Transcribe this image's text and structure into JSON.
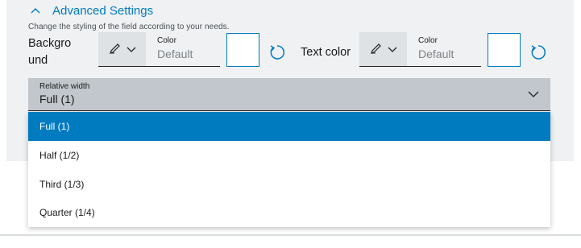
{
  "section": {
    "title": "Advanced Settings",
    "help": "Change the styling of the field according to your needs."
  },
  "background": {
    "label_line1": "Backgro",
    "label_line2": "und",
    "color_label": "Color",
    "color_value": "Default"
  },
  "text_color": {
    "label": "Text color",
    "color_label": "Color",
    "color_value": "Default"
  },
  "relative_width": {
    "label": "Relative width",
    "value": "Full (1)",
    "options": [
      "Full (1)",
      "Half (1/2)",
      "Third (1/3)",
      "Quarter (1/4)"
    ],
    "selected_index": 0
  },
  "colors": {
    "accent": "#007bc0",
    "panel": "#eff1f2",
    "select_bg": "#c1c7cc"
  },
  "icons": {
    "collapse": "chevron-up-icon",
    "picker": "pen-icon",
    "dropdown": "chevron-down-icon",
    "reset": "reset-icon"
  }
}
